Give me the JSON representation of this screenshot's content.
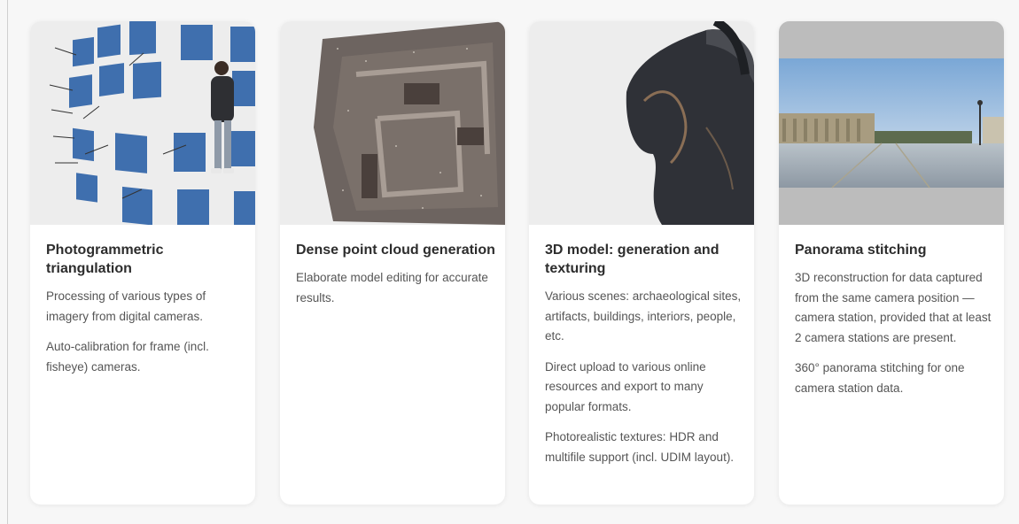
{
  "cards": [
    {
      "image": "photogrammetric-triangulation-image",
      "title": "Photogrammetric triangulation",
      "paragraphs": [
        "Processing of various types of imagery from digital cameras.",
        "Auto-calibration for frame (incl. fisheye) cameras."
      ]
    },
    {
      "image": "dense-point-cloud-image",
      "title": "Dense point cloud generation",
      "paragraphs": [
        "Elaborate model editing for accurate results."
      ]
    },
    {
      "image": "3d-model-image",
      "title": "3D model: generation and texturing",
      "paragraphs": [
        "Various scenes: archaeological sites, artifacts, buildings, interiors, people, etc.",
        "Direct upload to various online resources and export to many popular formats.",
        "Photorealistic textures: HDR and multifile support (incl. UDIM layout)."
      ]
    },
    {
      "image": "panorama-image",
      "title": "Panorama stitching",
      "paragraphs": [
        "3D reconstruction for data captured from the same camera position — camera station, provided that at least 2 camera stations are present.",
        "360° panorama stitching for one camera station data."
      ]
    }
  ],
  "colors": {
    "card_bg": "#ffffff",
    "page_bg": "#f7f7f7",
    "title": "#2d2d2d",
    "text": "#555555",
    "camera_blue": "#3f6fae"
  }
}
